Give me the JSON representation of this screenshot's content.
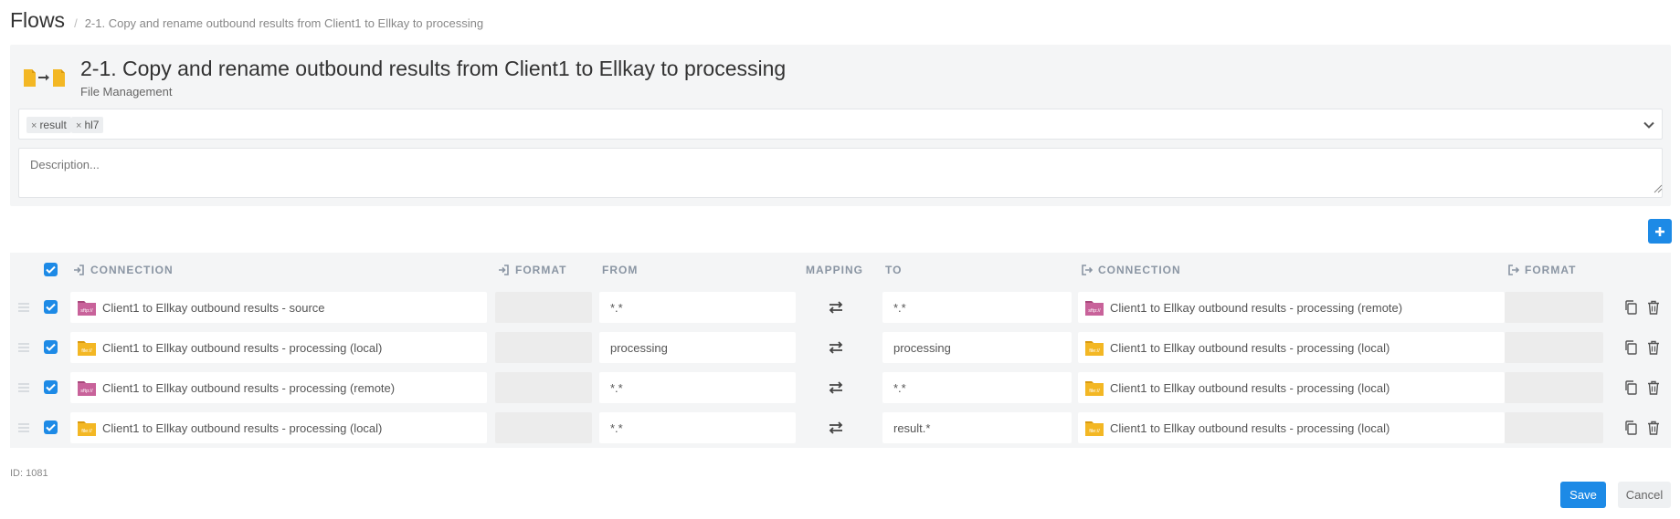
{
  "breadcrumb": {
    "root": "Flows",
    "separator": "/",
    "current": "2-1. Copy and rename outbound results from Client1 to Ellkay to processing"
  },
  "flow": {
    "title": "2-1. Copy and rename outbound results from Client1 to Ellkay to processing",
    "category": "File Management",
    "icon": "file-to-file-icon"
  },
  "tags": [
    {
      "remove": "×",
      "label": "result"
    },
    {
      "remove": "×",
      "label": "hl7"
    }
  ],
  "description": {
    "value": "",
    "placeholder": "Description..."
  },
  "table": {
    "headers": {
      "connection_in": "CONNECTION",
      "format_in": "FORMAT",
      "from": "FROM",
      "mapping": "MAPPING",
      "to": "TO",
      "connection_out": "CONNECTION",
      "format_out": "FORMAT"
    },
    "rows": [
      {
        "checked": true,
        "source_type": "sftp",
        "source_badge": "sftp://",
        "source": "Client1 to Ellkay outbound results - source",
        "format_in": "",
        "from": "*.*",
        "to": "*.*",
        "target_type": "sftp",
        "target_badge": "sftp://",
        "target": "Client1 to Ellkay outbound results - processing (remote)",
        "format_out": ""
      },
      {
        "checked": true,
        "source_type": "file",
        "source_badge": "file://",
        "source": "Client1 to Ellkay outbound results - processing (local)",
        "format_in": "",
        "from": "processing",
        "to": "processing",
        "target_type": "file",
        "target_badge": "file://",
        "target": "Client1 to Ellkay outbound results - processing (local)",
        "format_out": ""
      },
      {
        "checked": true,
        "source_type": "sftp",
        "source_badge": "sftp://",
        "source": "Client1 to Ellkay outbound results - processing (remote)",
        "format_in": "",
        "from": "*.*",
        "to": "*.*",
        "target_type": "file",
        "target_badge": "file://",
        "target": "Client1 to Ellkay outbound results - processing (local)",
        "format_out": ""
      },
      {
        "checked": true,
        "source_type": "file",
        "source_badge": "file://",
        "source": "Client1 to Ellkay outbound results - processing (local)",
        "format_in": "",
        "from": "*.*",
        "to": "result.*",
        "target_type": "file",
        "target_badge": "file://",
        "target": "Client1 to Ellkay outbound results - processing (local)",
        "format_out": ""
      }
    ]
  },
  "footer": {
    "id_label": "ID: 1081",
    "save": "Save",
    "cancel": "Cancel"
  },
  "colors": {
    "accent": "#1d8ae6",
    "sftp": "#c8629a",
    "file": "#f3b724",
    "panel": "#f4f5f6",
    "header_text": "#8a95a3"
  }
}
